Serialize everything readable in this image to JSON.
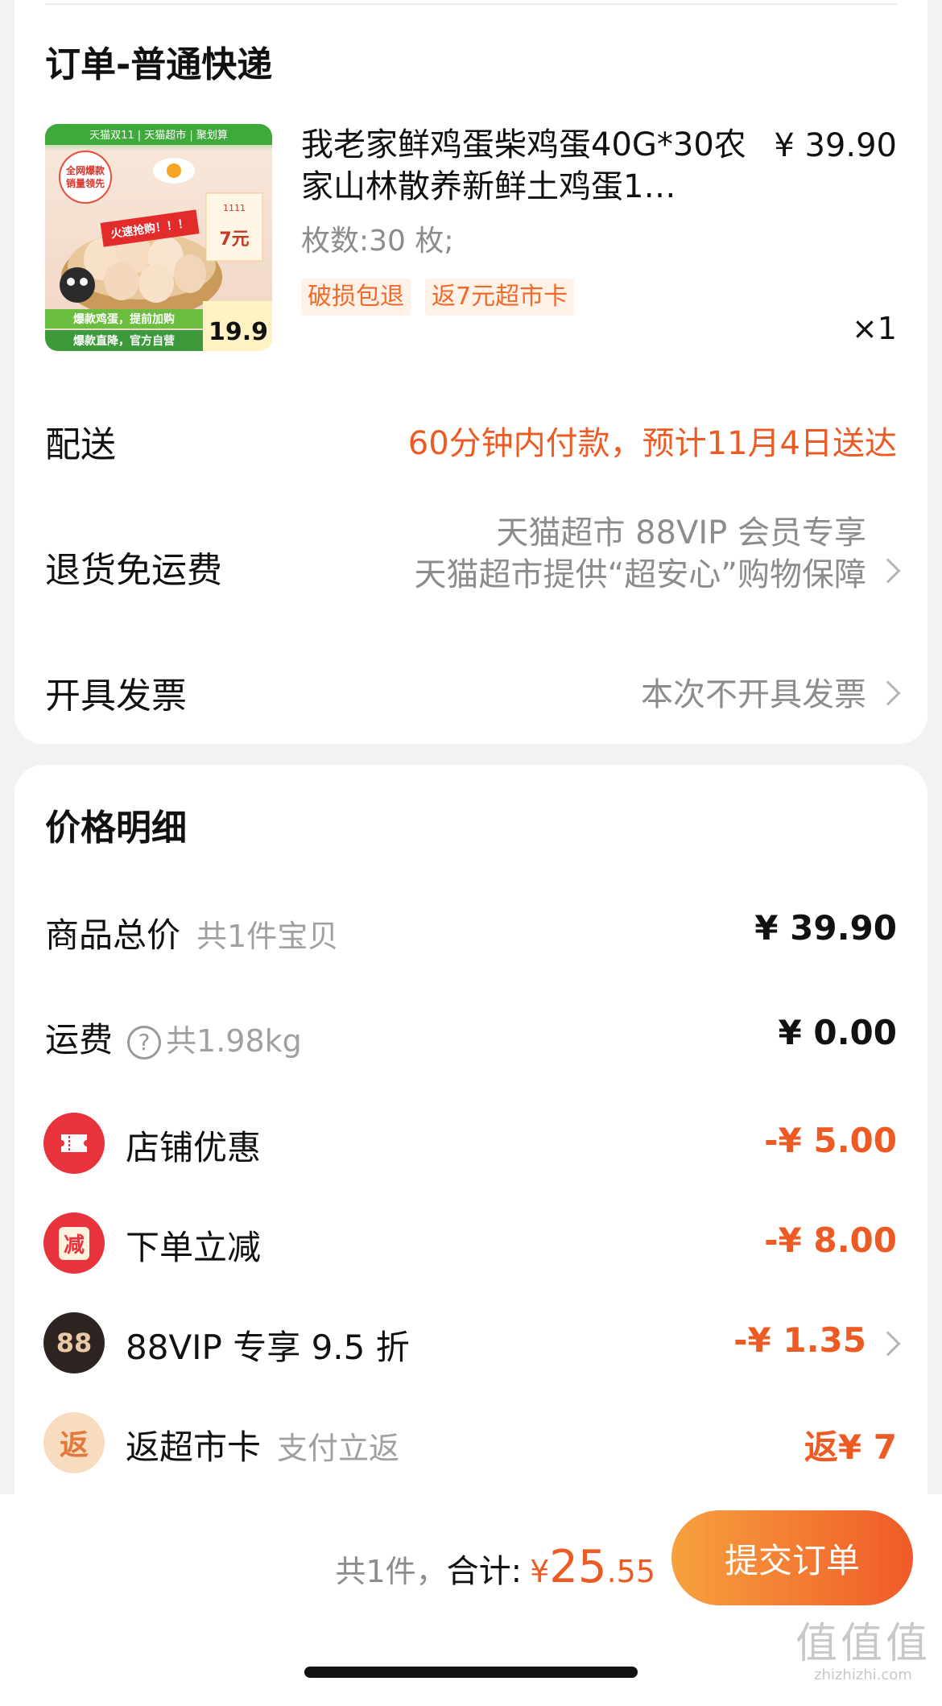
{
  "order": {
    "title": "订单-普通快递",
    "product": {
      "name": "我老家鲜鸡蛋柴鸡蛋40G*30农家山林散养新鲜土鸡蛋1…",
      "price": "¥ 39.90",
      "sku": "枚数:30 枚;",
      "tags": [
        "破损包退",
        "返7元超市卡"
      ],
      "qty": "×1",
      "thumb": {
        "banner": "天猫双11 | 天猫超市 | 聚划算",
        "badge": "全网爆款 销量领先",
        "promo": "火速抢购！！！",
        "slogan1": "爆款鸡蛋，提前加购",
        "slogan2": "爆款直降，官方自营",
        "price": "19.9"
      }
    },
    "delivery": {
      "label": "配送",
      "value": "60分钟内付款，预计11月4日送达"
    },
    "returns": {
      "label": "退货免运费",
      "line1": "天猫超市 88VIP 会员专享",
      "line2": "天猫超市提供“超安心”购物保障"
    },
    "invoice": {
      "label": "开具发票",
      "value": "本次不开具发票"
    }
  },
  "price_detail": {
    "title": "价格明细",
    "goods_total": {
      "label": "商品总价",
      "sub": "共1件宝贝",
      "amount": "¥ 39.90"
    },
    "shipping": {
      "label": "运费",
      "help": "?",
      "sub": "共1.98kg",
      "amount": "¥ 0.00"
    },
    "discounts": [
      {
        "label": "店铺优惠",
        "sub": "",
        "amount": "-¥ 5.00",
        "icon": "ticket-icon",
        "icon_text": "",
        "color": "#e8323c"
      },
      {
        "label": "下单立减",
        "sub": "",
        "amount": "-¥ 8.00",
        "icon": "minus-badge-icon",
        "icon_text": "减",
        "color": "#e8323c"
      },
      {
        "label": "88VIP 专享 9.5 折",
        "sub": "",
        "amount": "-¥ 1.35",
        "icon": "vip88-icon",
        "icon_text": "88",
        "color": "#2c2420"
      },
      {
        "label": "返超市卡",
        "sub": "支付立返",
        "amount": "返¥ 7",
        "icon": "rebate-icon",
        "icon_text": "返",
        "color": "#f7dcc0"
      }
    ]
  },
  "footer": {
    "count": "共1件，",
    "total_label": "合计:",
    "currency": "¥",
    "total_int": "25",
    "total_dec": ".55",
    "submit": "提交订单"
  },
  "watermark": {
    "big": "值值值",
    "small": "zhizhizhi.com"
  },
  "colors": {
    "accent": "#ec5b24",
    "discount_red": "#e8323c"
  }
}
